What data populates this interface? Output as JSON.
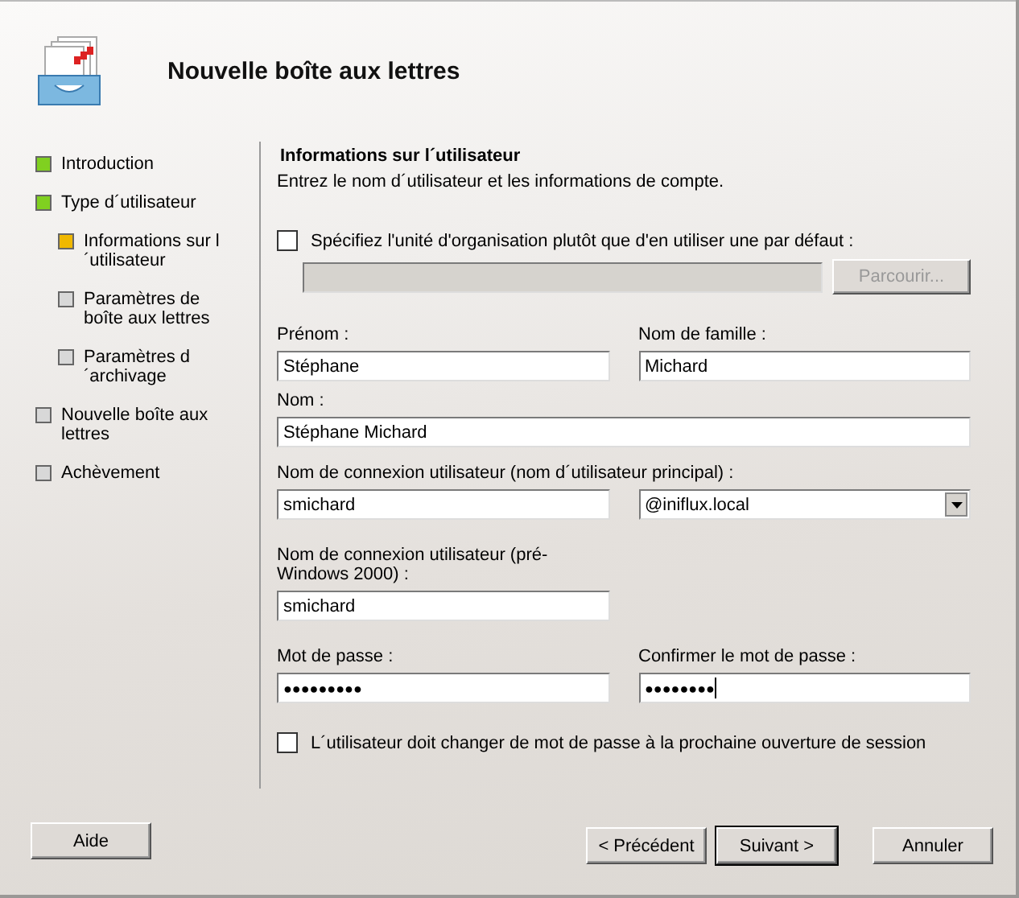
{
  "window": {
    "title": "Nouvelle boîte aux lettres"
  },
  "steps": [
    {
      "label": "Introduction",
      "color": "#80d020"
    },
    {
      "label": "Type d´utilisateur",
      "color": "#80d020",
      "children": [
        {
          "label": "Informations sur l´utilisateur",
          "color": "#f0b800"
        },
        {
          "label": "Paramètres de boîte aux lettres",
          "color": "#d8d8d8"
        },
        {
          "label": "Paramètres d´archivage",
          "color": "#d8d8d8"
        }
      ]
    },
    {
      "label": "Nouvelle boîte aux lettres",
      "color": "#d8d8d8"
    },
    {
      "label": "Achèvement",
      "color": "#d8d8d8"
    }
  ],
  "page": {
    "heading": "Informations sur l´utilisateur",
    "description": "Entrez le nom d´utilisateur et les informations de compte."
  },
  "ou_option": {
    "label": "Spécifiez l'unité d'organisation plutôt que d'en utiliser une par défaut :",
    "checked": false,
    "field_disabled": true,
    "browse": {
      "label": "Parcourir...",
      "disabled": true
    }
  },
  "first_name": {
    "label": "Prénom :",
    "value": "Stéphane"
  },
  "last_name": {
    "label": "Nom de famille :",
    "value": "Michard"
  },
  "name": {
    "label": "Nom :",
    "value": "Stéphane Michard"
  },
  "upn": {
    "label": "Nom de connexion utilisateur (nom d´utilisateur principal) :",
    "value": "smichard",
    "domain": "@iniflux.local"
  },
  "sam": {
    "label": "Nom de connexion utilisateur (pré-Windows 2000) :",
    "value": "smichard"
  },
  "password": {
    "label": "Mot de passe :",
    "value": "●●●●●●●●●"
  },
  "confirm": {
    "label": "Confirmer le mot de passe :",
    "value": "●●●●●●●●",
    "focused": true
  },
  "must_change": {
    "label": "L´utilisateur doit changer de mot de passe à la prochaine ouverture de session",
    "checked": false
  },
  "buttons": [
    {
      "label": "Aide",
      "kind": "help",
      "default": false
    },
    {
      "label": "< Précédent",
      "kind": "nav",
      "default": false
    },
    {
      "label": "Suivant >",
      "kind": "nav",
      "default": true
    },
    {
      "label": "Annuler",
      "kind": "nav",
      "default": false
    }
  ]
}
